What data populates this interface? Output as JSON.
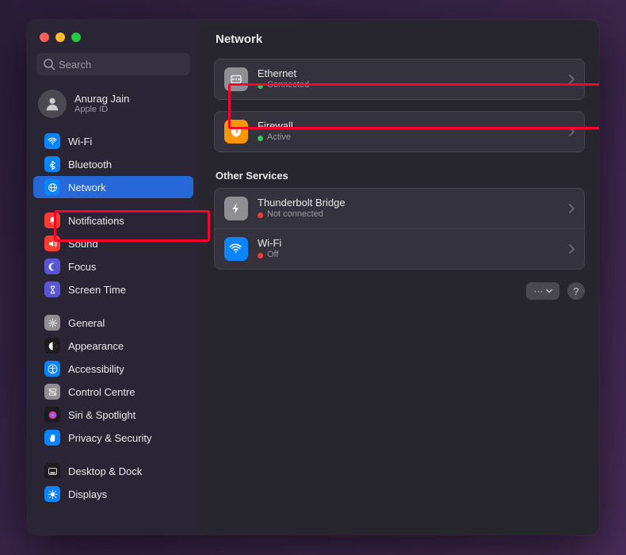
{
  "window": {
    "title": "Network"
  },
  "sidebar": {
    "search_placeholder": "Search",
    "account": {
      "name": "Anurag Jain",
      "subtitle": "Apple ID"
    },
    "items": [
      {
        "id": "wifi",
        "label": "Wi-Fi",
        "icon": "wifi-icon",
        "iconBg": "#0a84ff"
      },
      {
        "id": "bluetooth",
        "label": "Bluetooth",
        "icon": "bluetooth-icon",
        "iconBg": "#0a84ff"
      },
      {
        "id": "network",
        "label": "Network",
        "icon": "network-icon",
        "iconBg": "#0a84ff",
        "active": true
      },
      {
        "id": "notifications",
        "label": "Notifications",
        "icon": "bell-icon",
        "iconBg": "#ff3b30"
      },
      {
        "id": "sound",
        "label": "Sound",
        "icon": "sound-icon",
        "iconBg": "#ff3b30"
      },
      {
        "id": "focus",
        "label": "Focus",
        "icon": "moon-icon",
        "iconBg": "#5856d6"
      },
      {
        "id": "screentime",
        "label": "Screen Time",
        "icon": "hourglass-icon",
        "iconBg": "#5856d6"
      },
      {
        "id": "general",
        "label": "General",
        "icon": "gear-icon",
        "iconBg": "#8e8e93"
      },
      {
        "id": "appearance",
        "label": "Appearance",
        "icon": "appearance-icon",
        "iconBg": "#1c1c1e"
      },
      {
        "id": "accessibility",
        "label": "Accessibility",
        "icon": "accessibility-icon",
        "iconBg": "#0a84ff"
      },
      {
        "id": "controlcentre",
        "label": "Control Centre",
        "icon": "switches-icon",
        "iconBg": "#8e8e93"
      },
      {
        "id": "siri",
        "label": "Siri & Spotlight",
        "icon": "siri-icon",
        "iconBg": "#1c1c1e"
      },
      {
        "id": "privacy",
        "label": "Privacy & Security",
        "icon": "hand-icon",
        "iconBg": "#0a84ff"
      },
      {
        "id": "desktop",
        "label": "Desktop & Dock",
        "icon": "dock-icon",
        "iconBg": "#1c1c1e"
      },
      {
        "id": "displays",
        "label": "Displays",
        "icon": "displays-icon",
        "iconBg": "#0a84ff"
      }
    ]
  },
  "main": {
    "primary": [
      {
        "id": "ethernet",
        "title": "Ethernet",
        "status": "Connected",
        "statusColor": "green",
        "icon": "ethernet-icon",
        "iconBg": "#8e8e93"
      },
      {
        "id": "firewall",
        "title": "Firewall",
        "status": "Active",
        "statusColor": "green",
        "icon": "firewall-icon",
        "iconBg": "#ff9500"
      }
    ],
    "other_label": "Other Services",
    "other": [
      {
        "id": "thunderbolt",
        "title": "Thunderbolt Bridge",
        "status": "Not connected",
        "statusColor": "red",
        "icon": "thunderbolt-icon",
        "iconBg": "#8e8e93"
      },
      {
        "id": "wifi2",
        "title": "Wi-Fi",
        "status": "Off",
        "statusColor": "red",
        "icon": "wifi-icon",
        "iconBg": "#0a84ff"
      }
    ],
    "footer": {
      "more_label": "···",
      "help_label": "?"
    }
  },
  "colors": {
    "highlight": "#ff0028"
  }
}
